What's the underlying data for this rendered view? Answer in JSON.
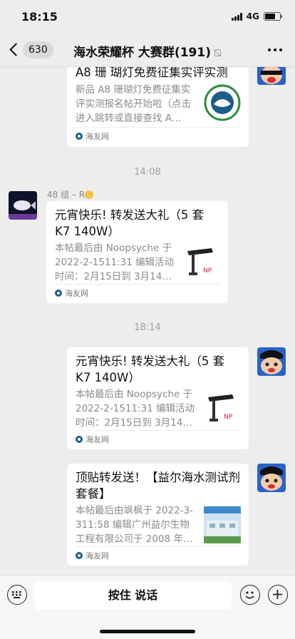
{
  "status": {
    "time": "18:15",
    "network": "4G"
  },
  "nav": {
    "back_count": "630",
    "title": "海水荣耀杯 大赛群(191)"
  },
  "messages": [
    {
      "title": "A8 珊 瑚灯免费征集实评实测",
      "desc": "新品 A8 珊瑚灯免费征集实评实测报名帖开始啦（点击进入跳转或直接查找 A…",
      "source": "海友网"
    },
    {
      "time": "14:08"
    },
    {
      "sender": "48 组 – R",
      "title": "元宵快乐! 转发送大礼（5 套 K7 140W）",
      "desc": "本帖最后由 Noopsyche 于 2022-2-1511:31 编辑活动时间：2月15日到 3月14…",
      "source": "海友网"
    },
    {
      "time": "18:14"
    },
    {
      "title": "元宵快乐! 转发送大礼（5 套 K7 140W）",
      "desc": "本帖最后由 Noopsyche 于 2022-2-1511:31 编辑活动时间：2月15日到 3月14…",
      "source": "海友网"
    },
    {
      "title": "顶贴转发送！【益尔海水测试剂套餐】",
      "desc": "本帖最后由飒枫于 2022-3-311:58 编辑广州益尔生物工程有限公司于 2008 年…",
      "source": "海友网"
    }
  ],
  "input": {
    "voice_label": "按住 说话"
  },
  "colors": {
    "background": "#ededed",
    "card": "#ffffff",
    "muted_text": "#8a8a8a"
  },
  "icons": [
    "back-icon",
    "mute-icon",
    "more-icon",
    "keyboard-icon",
    "emoji-icon",
    "plus-icon",
    "source-icon"
  ]
}
